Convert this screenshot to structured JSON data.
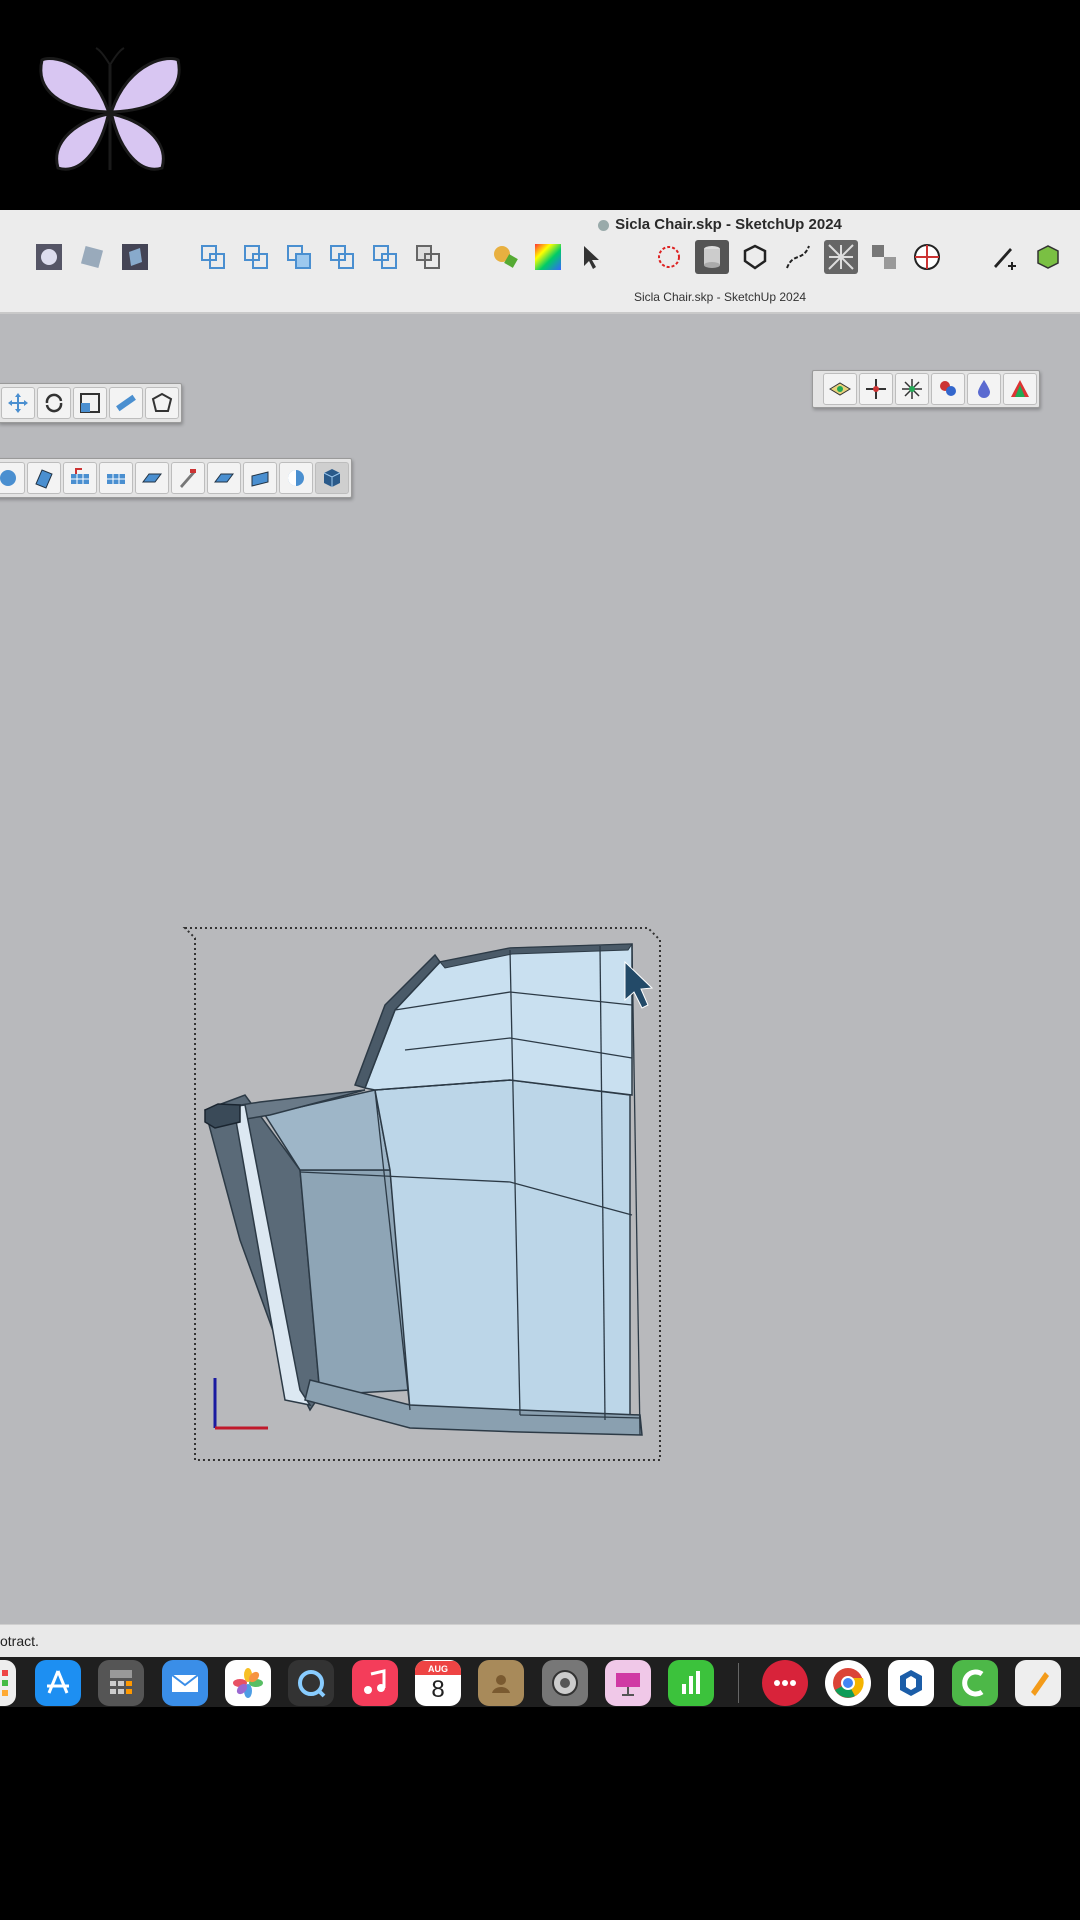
{
  "window": {
    "title": "Sicla Chair.skp - SketchUp 2024",
    "subtitle": "Sicla Chair.skp - SketchUp 2024"
  },
  "toolbar_icons": [
    "styles-icon",
    "style-edit-icon",
    "style-apply-icon",
    "view-iso-icon",
    "view-top-icon",
    "view-front-icon",
    "view-right-icon",
    "view-back-icon",
    "view-left-icon",
    "paint-bucket-icon",
    "color-palette-icon",
    "select-tool-icon",
    "lasso-select-icon",
    "cylinder-icon",
    "solid-tools-icon",
    "curve-icon",
    "texture-icon",
    "component-icon",
    "sphere-icon",
    "pen-plus-icon",
    "cube-green-icon"
  ],
  "float_toolbar_1": [
    "move-icon",
    "rotate-icon",
    "scale-icon",
    "tape-measure-icon",
    "protractor-icon"
  ],
  "float_toolbar_2": [
    "sandbox-icon",
    "push-pull-icon",
    "grid-icon",
    "smoove-icon",
    "stamp-icon",
    "drape-icon",
    "flip-edge-icon",
    "add-detail-icon",
    "contour-icon",
    "box-3d-icon"
  ],
  "float_toolbar_3": [
    "axis-icon",
    "vertex-icon",
    "network-icon",
    "paint-icon",
    "drop-icon",
    "tent-icon"
  ],
  "status_bar": {
    "text": "otract."
  },
  "dock": {
    "calendar_month": "AUG",
    "calendar_day": "8",
    "apps": [
      "launchpad-icon",
      "app-store-icon",
      "calculator-icon",
      "mail-icon",
      "photos-icon",
      "quicktime-icon",
      "music-icon",
      "calendar-icon",
      "contacts-icon",
      "system-settings-icon",
      "keynote-icon",
      "numbers-icon",
      "more-icon",
      "chrome-icon",
      "sketchup-icon",
      "camtasia-icon",
      "pages-icon"
    ]
  },
  "colors": {
    "viewport": "#b8b9bc",
    "model_face": "#bcd6e8",
    "model_edge": "#2c3a46",
    "axis_red": "#c0192b",
    "axis_blue": "#1a1aa0"
  }
}
